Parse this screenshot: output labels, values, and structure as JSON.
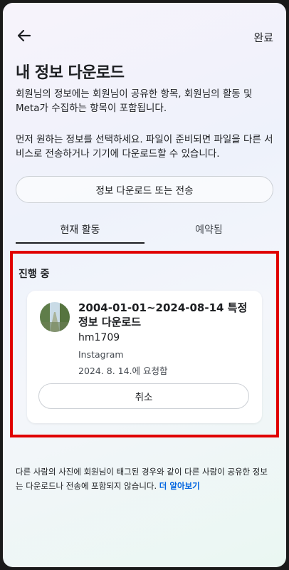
{
  "header": {
    "done_label": "완료"
  },
  "page_title": "내 정보 다운로드",
  "description": [
    "회원님의 정보에는 회원님이 공유한 항목, 회원님의 활동 및 Meta가 수집하는 항목이 포함됩니다.",
    "먼저 원하는 정보를 선택하세요. 파일이 준비되면 파일을 다른 서비스로 전송하거나 기기에 다운로드할 수 있습니다."
  ],
  "primary_button": "정보 다운로드 또는 전송",
  "tabs": [
    {
      "label": "현재 활동",
      "active": true
    },
    {
      "label": "예약됨",
      "active": false
    }
  ],
  "in_progress": {
    "section_title": "진행 중",
    "item": {
      "title": "2004-01-01~2024-08-14 특정 정보 다운로드",
      "username": "hm1709",
      "app": "Instagram",
      "requested": "2024. 8. 14.에 요청함",
      "cancel_label": "취소"
    }
  },
  "footer": {
    "text": "다른 사람의 사진에 회원님이 태그된 경우와 같이 다른 사람이 공유한 정보는 다운로드나 전송에 포함되지 않습니다.",
    "link": "더 알아보기"
  },
  "colors": {
    "accent": "#0064e0",
    "highlight": "#e00000"
  }
}
